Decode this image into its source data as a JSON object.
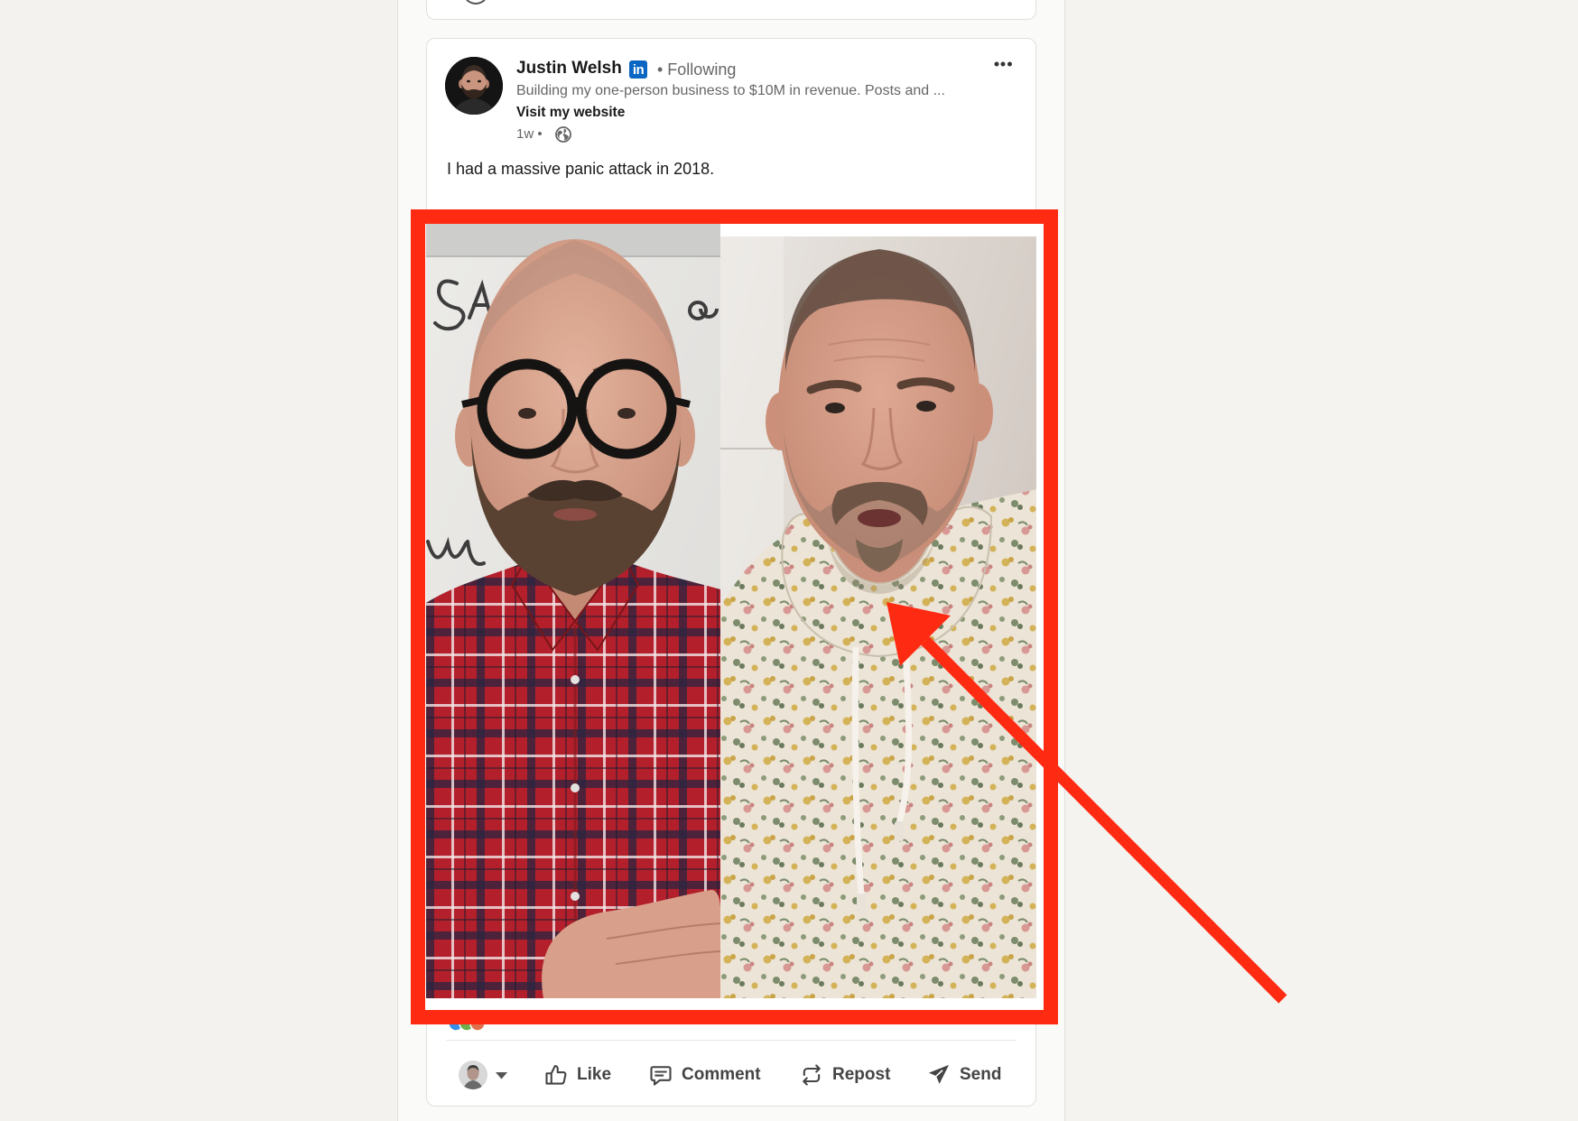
{
  "colors": {
    "page_background": "#f3f2ee",
    "annotation_red": "#ff2a12",
    "linkedin_blue": "#0a66c2",
    "text_primary": "#191919",
    "text_secondary": "#666666",
    "card_border": "#e0dfdc"
  },
  "post": {
    "author": {
      "name": "Justin Welsh",
      "badge_icon": "linkedin-icon",
      "badge_text": "in",
      "following": "• Following",
      "headline": "Building my one-person business to $10M in revenue. Posts and ...",
      "website_link": "Visit my website",
      "timestamp": "1w •",
      "visibility_icon": "globe-icon"
    },
    "menu_icon": "more-icon",
    "text": "I had a massive panic attack in 2018.",
    "reaction_icons": [
      "like-reaction-icon",
      "celebrate-reaction-icon",
      "love-reaction-icon"
    ],
    "actions": {
      "identity_icon": "avatar-icon",
      "dropdown_icon": "caret-down-icon",
      "like": {
        "icon": "thumbs-up-icon",
        "label": "Like"
      },
      "comment": {
        "icon": "comment-icon",
        "label": "Comment"
      },
      "repost": {
        "icon": "repost-icon",
        "label": "Repost"
      },
      "send": {
        "icon": "send-icon",
        "label": "Send"
      }
    }
  }
}
